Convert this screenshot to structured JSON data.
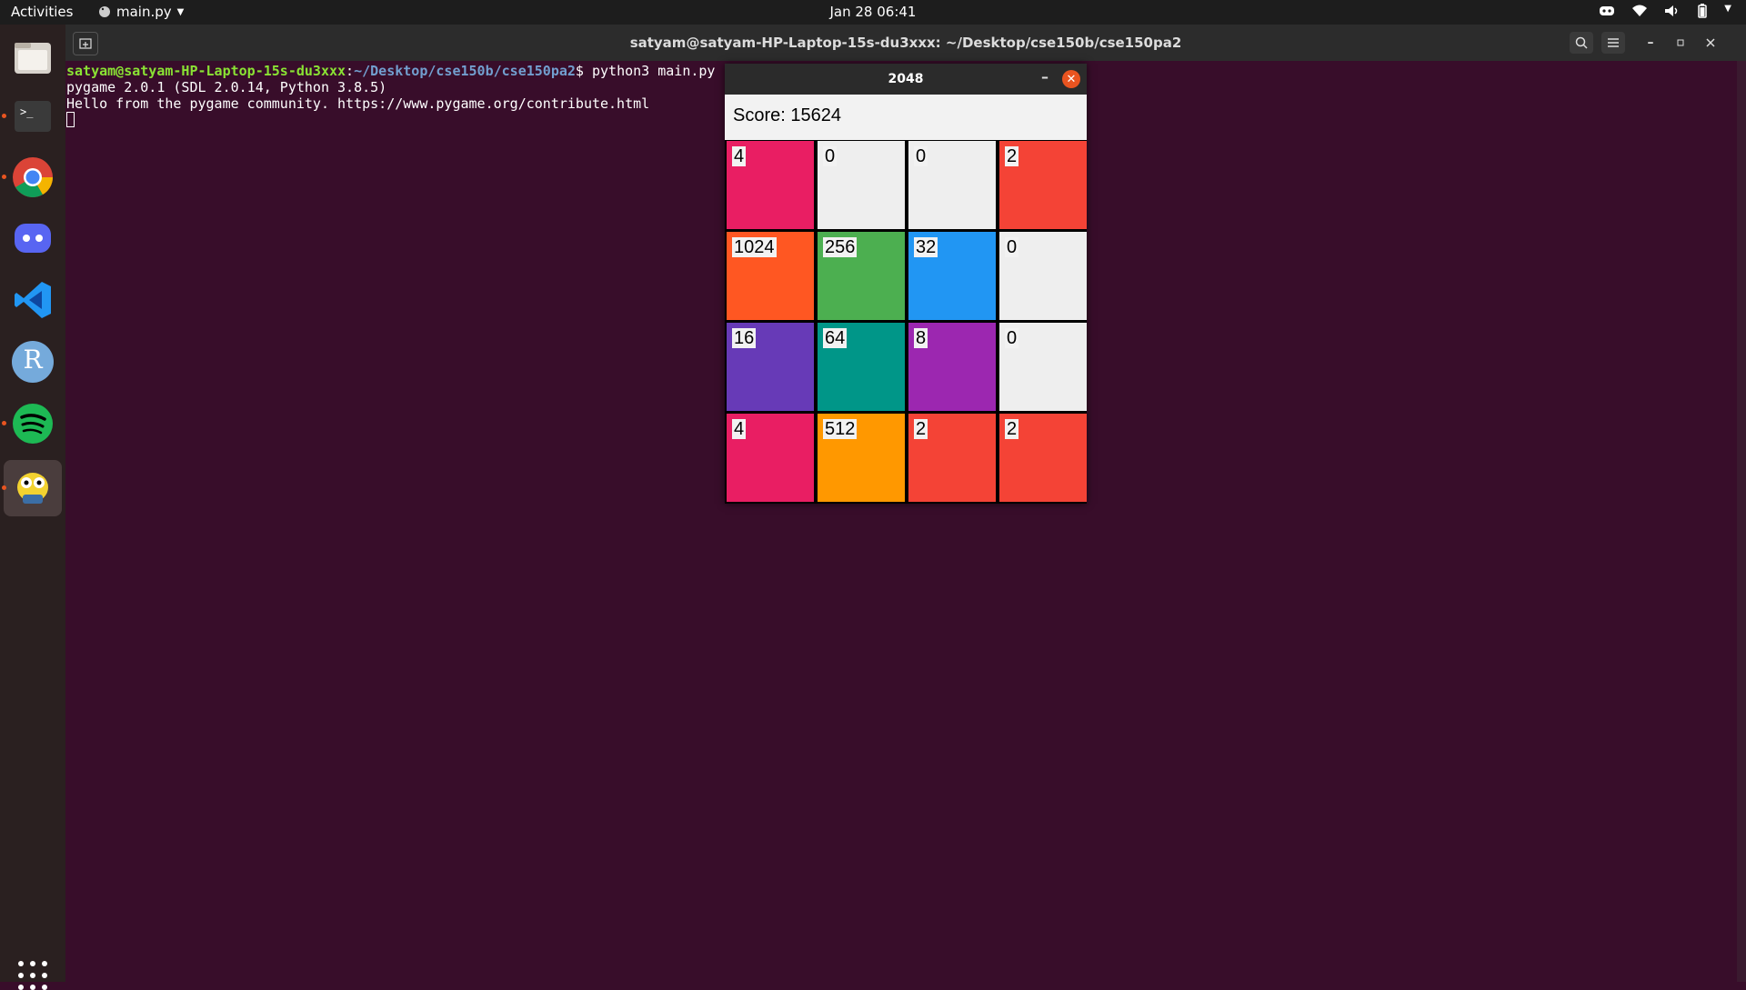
{
  "topbar": {
    "activities": "Activities",
    "app_menu": "main.py",
    "clock": "Jan 28  06:41"
  },
  "terminal": {
    "title": "satyam@satyam-HP-Laptop-15s-du3xxx: ~/Desktop/cse150b/cse150pa2",
    "prompt_user": "satyam@satyam-HP-Laptop-15s-du3xxx",
    "prompt_sep": ":",
    "prompt_path": "~/Desktop/cse150b/cse150pa2",
    "command": "$ python3 main.py",
    "line2": "pygame 2.0.1 (SDL 2.0.14, Python 3.8.5)",
    "line3": "Hello from the pygame community. https://www.pygame.org/contribute.html"
  },
  "game": {
    "title": "2048",
    "score_text": "Score: 15624",
    "tiles": [
      {
        "value": "4",
        "color": "#e91e63"
      },
      {
        "value": "0",
        "color": "#eeeeee"
      },
      {
        "value": "0",
        "color": "#eeeeee"
      },
      {
        "value": "2",
        "color": "#f44336"
      },
      {
        "value": "1024",
        "color": "#ff5722"
      },
      {
        "value": "256",
        "color": "#4caf50"
      },
      {
        "value": "32",
        "color": "#2196f3"
      },
      {
        "value": "0",
        "color": "#eeeeee"
      },
      {
        "value": "16",
        "color": "#673ab7"
      },
      {
        "value": "64",
        "color": "#009688"
      },
      {
        "value": "8",
        "color": "#9c27b0"
      },
      {
        "value": "0",
        "color": "#eeeeee"
      },
      {
        "value": "4",
        "color": "#e91e63"
      },
      {
        "value": "512",
        "color": "#ff9800"
      },
      {
        "value": "2",
        "color": "#f44336"
      },
      {
        "value": "2",
        "color": "#f44336"
      }
    ]
  },
  "dock": {
    "items": [
      "files-icon",
      "terminal-icon",
      "chrome-icon",
      "discord-icon",
      "vscode-icon",
      "r-icon",
      "spotify-icon",
      "python-app-icon"
    ],
    "r_letter": "R"
  }
}
